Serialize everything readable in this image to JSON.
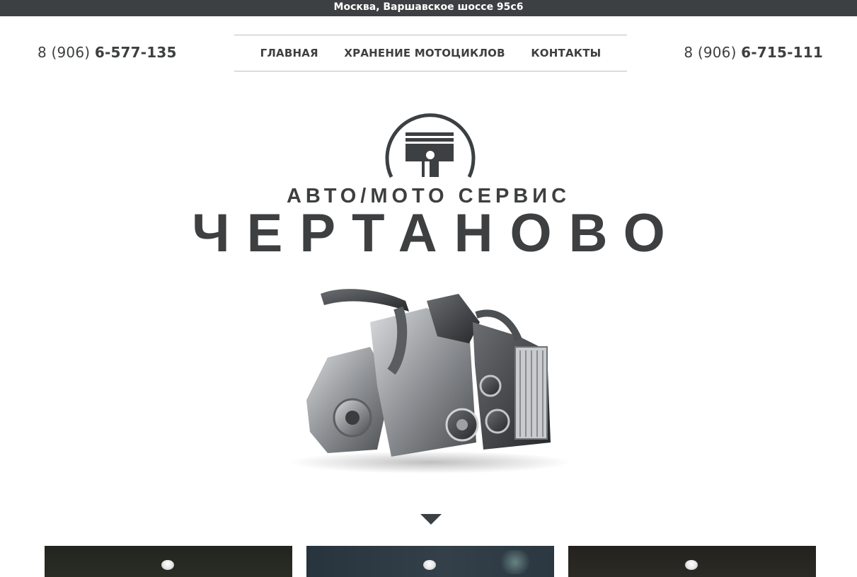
{
  "topbar": {
    "address": "Москва, Варшавское шоссе 95с6"
  },
  "phones": {
    "left": {
      "prefix": "8 (906) ",
      "number": "6-577-135"
    },
    "right": {
      "prefix": "8 (906) ",
      "number": "6-715-111"
    }
  },
  "nav": {
    "items": [
      {
        "label": "ГЛАВНАЯ"
      },
      {
        "label": "ХРАНЕНИЕ МОТОЦИКЛОВ"
      },
      {
        "label": "КОНТАКТЫ"
      }
    ]
  },
  "hero": {
    "subtitle": "АВТО/МОТО СЕРВИС",
    "title": "ЧЕРТАНОВО",
    "logo_icon": "piston-icon",
    "image_icon": "engine-image",
    "scroll_icon": "arrow-down-icon"
  },
  "colors": {
    "dark": "#3d4042",
    "text": "#3d3f40",
    "divider": "#bfbfbf"
  }
}
